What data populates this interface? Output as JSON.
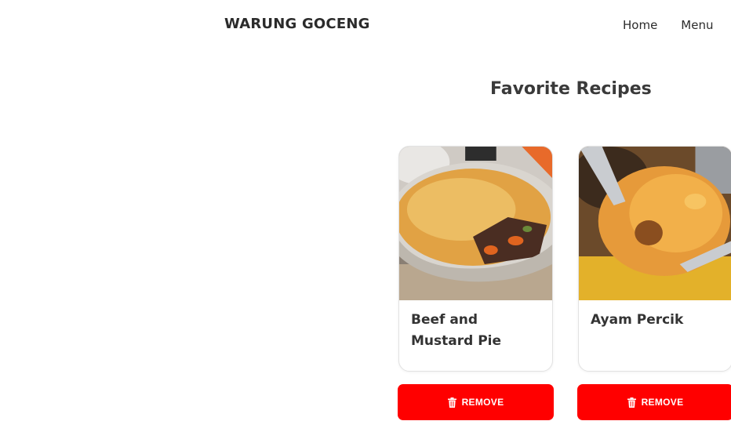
{
  "header": {
    "brand": "WARUNG GOCENG",
    "nav": [
      {
        "label": "Home"
      },
      {
        "label": "Menu"
      }
    ]
  },
  "main": {
    "title": "Favorite Recipes",
    "cards": [
      {
        "name": "Beef and Mustard Pie",
        "image": "beef-and-mustard-pie-photo",
        "remove_label": "REMOVE"
      },
      {
        "name": "Ayam Percik",
        "image": "ayam-percik-photo",
        "remove_label": "REMOVE"
      }
    ]
  },
  "colors": {
    "accent_red": "#ff0000",
    "text_dark": "#2b2b2b",
    "card_border": "#e2e2e2"
  },
  "icons": {
    "remove": "trash-icon"
  }
}
